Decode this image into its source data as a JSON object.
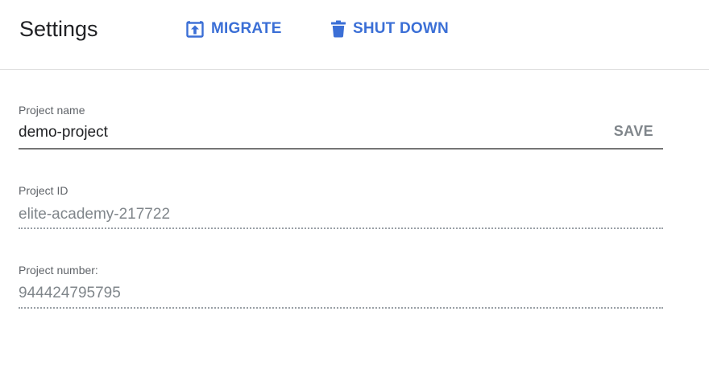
{
  "header": {
    "title": "Settings",
    "actions": {
      "migrate_label": "MIGRATE",
      "migrate_icon": "upload-box-icon",
      "shutdown_label": "SHUT DOWN",
      "shutdown_icon": "trash-icon"
    }
  },
  "form": {
    "project_name": {
      "label": "Project name",
      "value": "demo-project",
      "save_label": "SAVE"
    },
    "project_id": {
      "label": "Project ID",
      "value": "elite-academy-217722"
    },
    "project_number": {
      "label": "Project number:",
      "value": "944424795795"
    }
  },
  "colors": {
    "accent": "#3b6fd6",
    "title": "#202124",
    "muted": "#80868b"
  }
}
